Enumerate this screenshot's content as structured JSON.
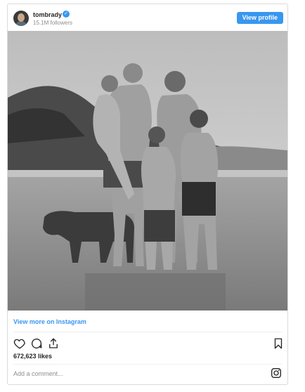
{
  "header": {
    "username": "tombrady",
    "verified_icon": "verified-badge-icon",
    "followers": "15.1M followers",
    "view_profile_label": "View profile",
    "accent_color": "#3897f0"
  },
  "post": {
    "photo_description_icon": "photo-image",
    "view_more_label": "View more on Instagram",
    "actions": [
      "heart-icon",
      "comment-icon",
      "share-icon",
      "bookmark-icon"
    ],
    "likes": "672,623 likes",
    "comment_placeholder": "Add a comment...",
    "brand_icon": "instagram-icon"
  }
}
